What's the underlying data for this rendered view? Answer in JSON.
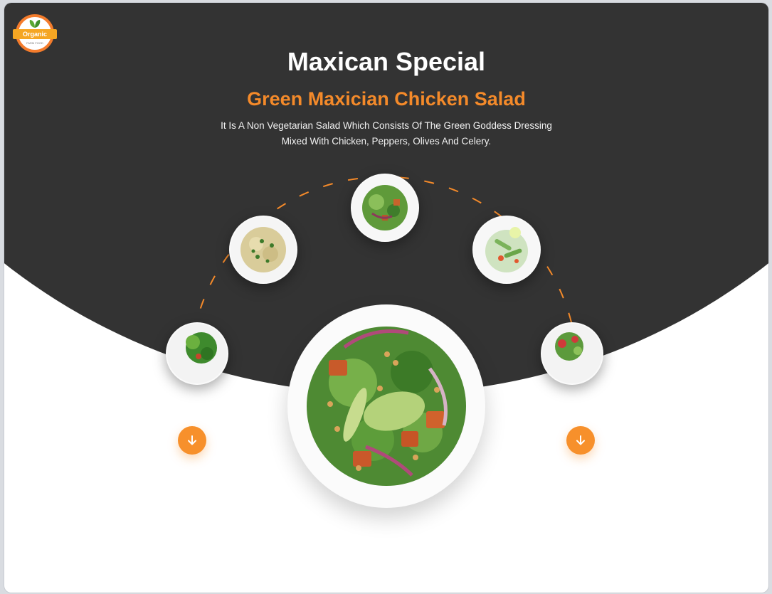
{
  "logo": {
    "ribbon_text": "Organic",
    "sub_text": "FARM FOOD"
  },
  "hero": {
    "title": "Maxican Special",
    "subtitle": "Green Maxician Chicken Salad",
    "description": "It Is A Non Vegetarian Salad Which Consists Of The Green Goddess Dressing Mixed With Chicken, Peppers, Olives And Celery."
  },
  "colors": {
    "accent": "#f48a2a",
    "dark_bg": "#333333",
    "button": "#f7902b",
    "page_bg": "#ffffff"
  },
  "carousel": {
    "plates": [
      {
        "name": "plate-left-lower",
        "dish": "leafy-greens-salad"
      },
      {
        "name": "plate-left-upper",
        "dish": "pasta-salad"
      },
      {
        "name": "plate-top",
        "dish": "mixed-salad"
      },
      {
        "name": "plate-right-upper",
        "dish": "cucumber-salad"
      },
      {
        "name": "plate-right-lower",
        "dish": "tomato-salad"
      }
    ],
    "featured": {
      "dish": "avocado-chickpea-salad"
    },
    "prev_icon": "arrow-down-icon",
    "next_icon": "arrow-down-icon"
  }
}
